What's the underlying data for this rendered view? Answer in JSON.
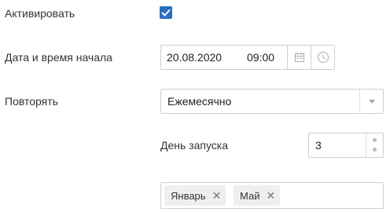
{
  "activate": {
    "label": "Активировать",
    "checked": true
  },
  "start": {
    "label": "Дата и время начала",
    "date": "20.08.2020",
    "time": "09:00"
  },
  "repeat": {
    "label": "Повторять",
    "value": "Ежемесячно"
  },
  "start_day": {
    "label": "День запуска",
    "value": "3"
  },
  "months": {
    "tags": [
      {
        "label": "Январь"
      },
      {
        "label": "Май"
      }
    ]
  },
  "colors": {
    "accent": "#2a6fbf",
    "border": "#cfcfcf",
    "tag_bg": "#efefef"
  }
}
